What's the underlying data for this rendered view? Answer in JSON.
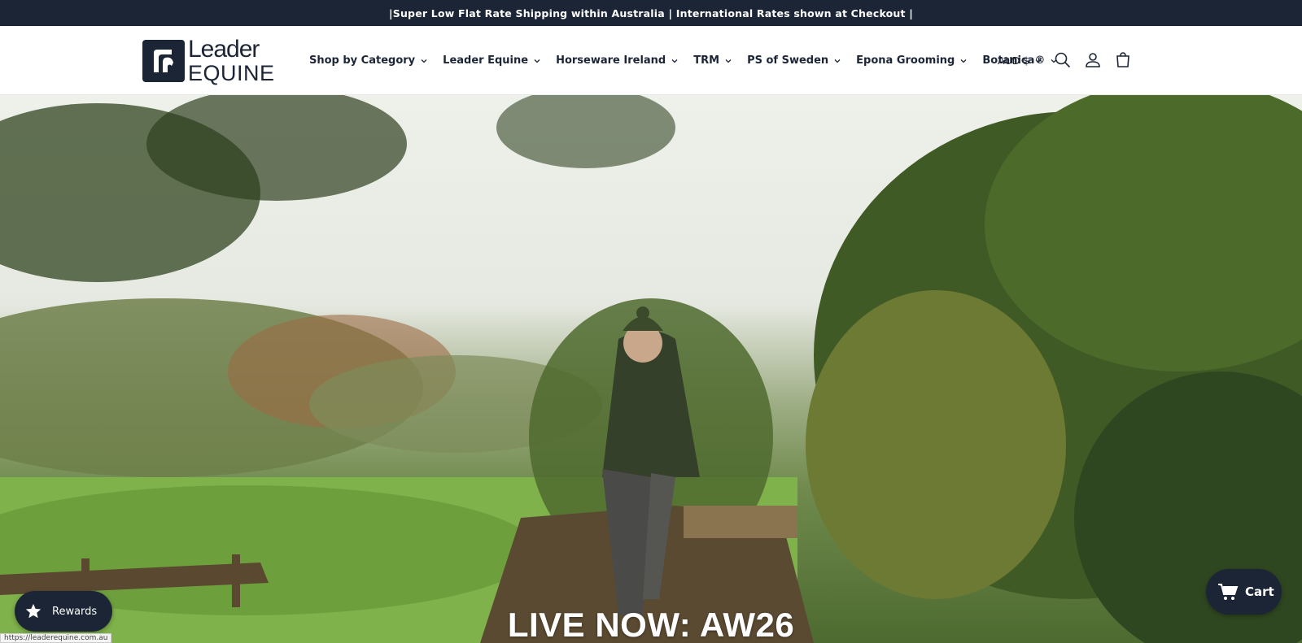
{
  "announcement": "|Super Low Flat Rate Shipping within Australia | International Rates shown at Checkout |",
  "logo": {
    "line1": "Leader",
    "line2": "EQUINE"
  },
  "nav": [
    {
      "label": "Shop by Category"
    },
    {
      "label": "Leader Equine"
    },
    {
      "label": "Horseware Ireland"
    },
    {
      "label": "TRM"
    },
    {
      "label": "PS of Sweden"
    },
    {
      "label": "Epona Grooming"
    },
    {
      "label": "Botanica®"
    }
  ],
  "currency": "AUD $",
  "header_icons": [
    "search-icon",
    "account-icon",
    "cart-icon"
  ],
  "hero": {
    "title": "LIVE NOW: AW26"
  },
  "rewards": {
    "label": "Rewards"
  },
  "cart_button": {
    "label": "Cart"
  },
  "status_url": "https://leaderequine.com.au",
  "colors": {
    "brand": "#1c2536",
    "white": "#ffffff"
  }
}
